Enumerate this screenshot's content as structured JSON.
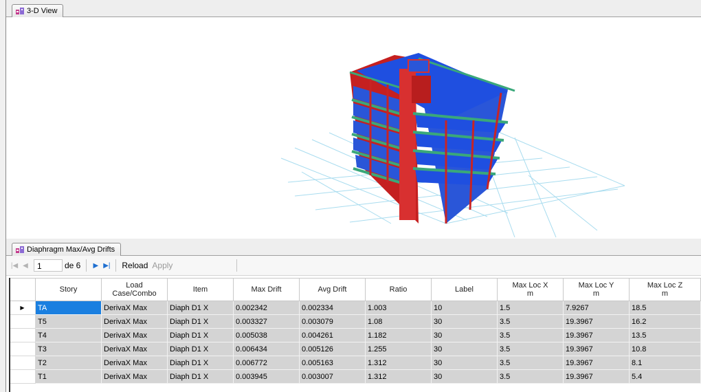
{
  "top_tab": {
    "label": "3-D View",
    "icon": "structure-view-icon"
  },
  "bottom_tab": {
    "label": "Diaphragm Max/Avg Drifts",
    "icon": "table-view-icon"
  },
  "pager": {
    "page": "1",
    "of_label": "de 6",
    "reload_label": "Reload",
    "apply_label": "Apply"
  },
  "table": {
    "columns": [
      "",
      "Story",
      "Load Case/Combo",
      "Item",
      "Max Drift",
      "Avg Drift",
      "Ratio",
      "Label",
      "Max Loc X m",
      "Max Loc Y m",
      "Max Loc Z m"
    ],
    "headers": {
      "story": "Story",
      "load1": "Load",
      "load2": "Case/Combo",
      "item": "Item",
      "max_drift": "Max Drift",
      "avg_drift": "Avg Drift",
      "ratio": "Ratio",
      "label": "Label",
      "locx": "Max Loc X",
      "locy": "Max Loc Y",
      "locz": "Max Loc Z",
      "unit": "m"
    },
    "rows": [
      [
        "TA",
        "DerivaX Max",
        "Diaph D1 X",
        "0.002342",
        "0.002334",
        "1.003",
        "10",
        "1.5",
        "7.9267",
        "18.5"
      ],
      [
        "T5",
        "DerivaX Max",
        "Diaph D1 X",
        "0.003327",
        "0.003079",
        "1.08",
        "30",
        "3.5",
        "19.3967",
        "16.2"
      ],
      [
        "T4",
        "DerivaX Max",
        "Diaph D1 X",
        "0.005038",
        "0.004261",
        "1.182",
        "30",
        "3.5",
        "19.3967",
        "13.5"
      ],
      [
        "T3",
        "DerivaX Max",
        "Diaph D1 X",
        "0.006434",
        "0.005126",
        "1.255",
        "30",
        "3.5",
        "19.3967",
        "10.8"
      ],
      [
        "T2",
        "DerivaX Max",
        "Diaph D1 X",
        "0.006772",
        "0.005163",
        "1.312",
        "30",
        "3.5",
        "19.3967",
        "8.1"
      ],
      [
        "T1",
        "DerivaX Max",
        "Diaph D1 X",
        "0.003945",
        "0.003007",
        "1.312",
        "30",
        "3.5",
        "19.3967",
        "5.4"
      ]
    ],
    "selected_row": 0
  },
  "colors": {
    "slab": "#1f4fe0",
    "beam_green": "#2f9e6c",
    "column_red": "#d02020",
    "grid_line": "#aee0f0",
    "selection": "#1a7fe0",
    "cell_bg": "#d4d4d4"
  }
}
